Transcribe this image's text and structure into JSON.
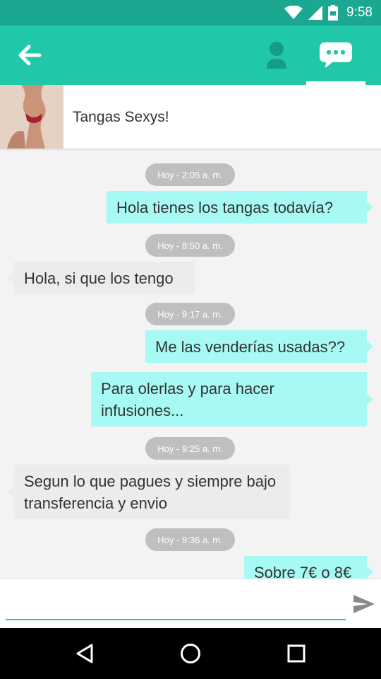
{
  "status_bar": {
    "time": "9:58"
  },
  "header": {
    "back_icon": "arrow-left-icon",
    "tabs": [
      {
        "icon": "person-icon",
        "active": false
      },
      {
        "icon": "chat-bubble-icon",
        "active": true
      }
    ],
    "accent_color": "#20c7a9",
    "status_color": "#1aa890"
  },
  "product": {
    "title": "Tangas Sexys!"
  },
  "messages": [
    {
      "type": "time",
      "text": "Hoy - 2:05 a. m."
    },
    {
      "type": "sent",
      "text": "Hola  tienes los tangas todavía?"
    },
    {
      "type": "time",
      "text": "Hoy - 8:50 a. m."
    },
    {
      "type": "received",
      "text": "Hola, si que los tengo"
    },
    {
      "type": "time",
      "text": "Hoy - 9:17 a. m."
    },
    {
      "type": "sent",
      "text": "Me las venderías usadas??"
    },
    {
      "type": "sent",
      "text": "Para olerlas y para hacer infusiones..."
    },
    {
      "type": "time",
      "text": "Hoy - 9:25 a. m."
    },
    {
      "type": "received",
      "text": "Segun lo que pagues y siempre bajo transferencia y envio"
    },
    {
      "type": "time",
      "text": "Hoy - 9:36 a. m."
    },
    {
      "type": "sent",
      "text": "Sobre 7€ o 8€"
    }
  ],
  "composer": {
    "value": "",
    "placeholder": "",
    "send_icon": "send-icon"
  },
  "nav": {
    "icons": [
      "back-triangle-icon",
      "home-circle-icon",
      "recents-square-icon"
    ]
  },
  "colors": {
    "sent_bubble": "#a7faf3",
    "received_bubble": "#ececec",
    "time_pill": "#bfbfbf"
  }
}
